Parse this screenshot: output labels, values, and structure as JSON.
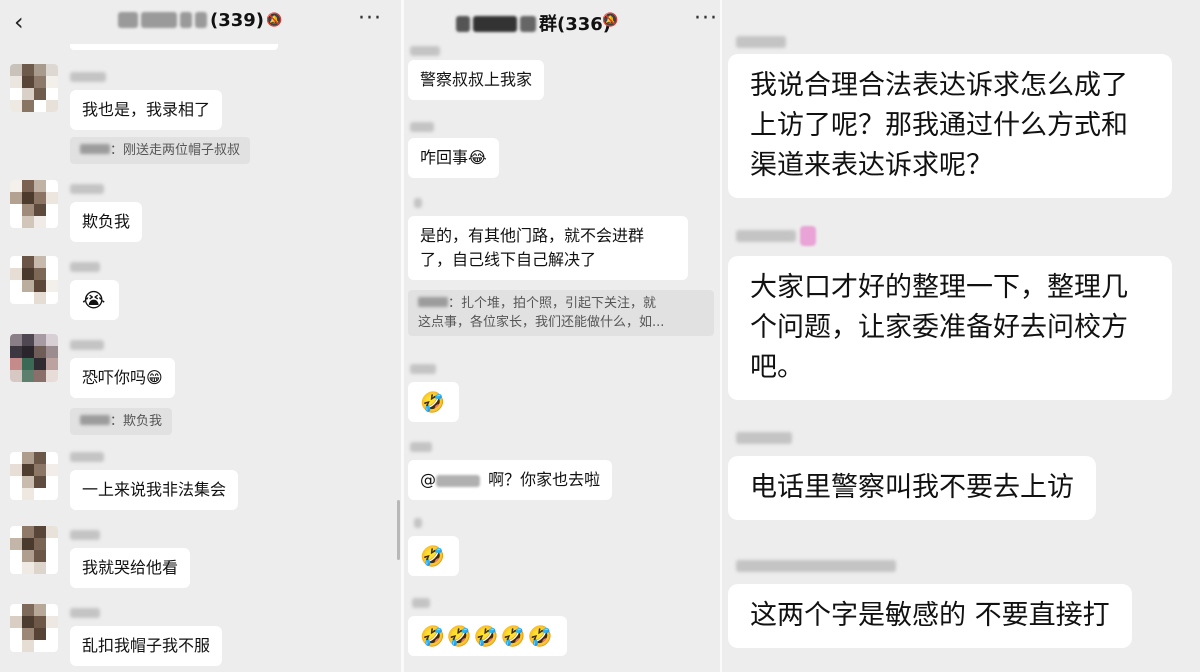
{
  "panel1": {
    "group_count": "(339)",
    "messages": [
      {
        "text": "我也是，我录相了"
      },
      {
        "quote": "：刚送走两位帽子叔叔"
      },
      {
        "text": "欺负我"
      },
      {
        "text": "😭"
      },
      {
        "text": "恐吓你吗😁"
      },
      {
        "quote": "：欺负我"
      },
      {
        "text": "一上来说我非法集会"
      },
      {
        "text": "我就哭给他看"
      },
      {
        "text": "乱扣我帽子我不服"
      }
    ]
  },
  "panel2": {
    "group_title": "群(336)",
    "messages": [
      {
        "text": "警察叔叔上我家"
      },
      {
        "text": "咋回事😂"
      },
      {
        "text_line1": "是的，有其他门路，就不会进群",
        "text_line2": "了，自己线下自己解决了"
      },
      {
        "quote_line1": "：扎个堆，拍个照，引起下关注，就",
        "quote_line2": "这点事，各位家长，我们还能做什么，如..."
      },
      {
        "text": "🤣"
      },
      {
        "mention": "@",
        "text": "啊？你家也去啦"
      },
      {
        "text": "🤣"
      },
      {
        "text": "🤣🤣🤣🤣🤣"
      }
    ]
  },
  "panel3": {
    "messages": [
      {
        "text": "我说合理合法表达诉求怎么成了上访了呢？那我通过什么方式和渠道来表达诉求呢？"
      },
      {
        "text": "大家口才好的整理一下，整理几个问题，让家委准备好去问校方吧。"
      },
      {
        "text": "电话里警察叫我不要去上访"
      },
      {
        "text": "这两个字是敏感的 不要直接打"
      }
    ]
  },
  "icons": {
    "back": "‹",
    "mute": "🔕",
    "more": "···"
  }
}
